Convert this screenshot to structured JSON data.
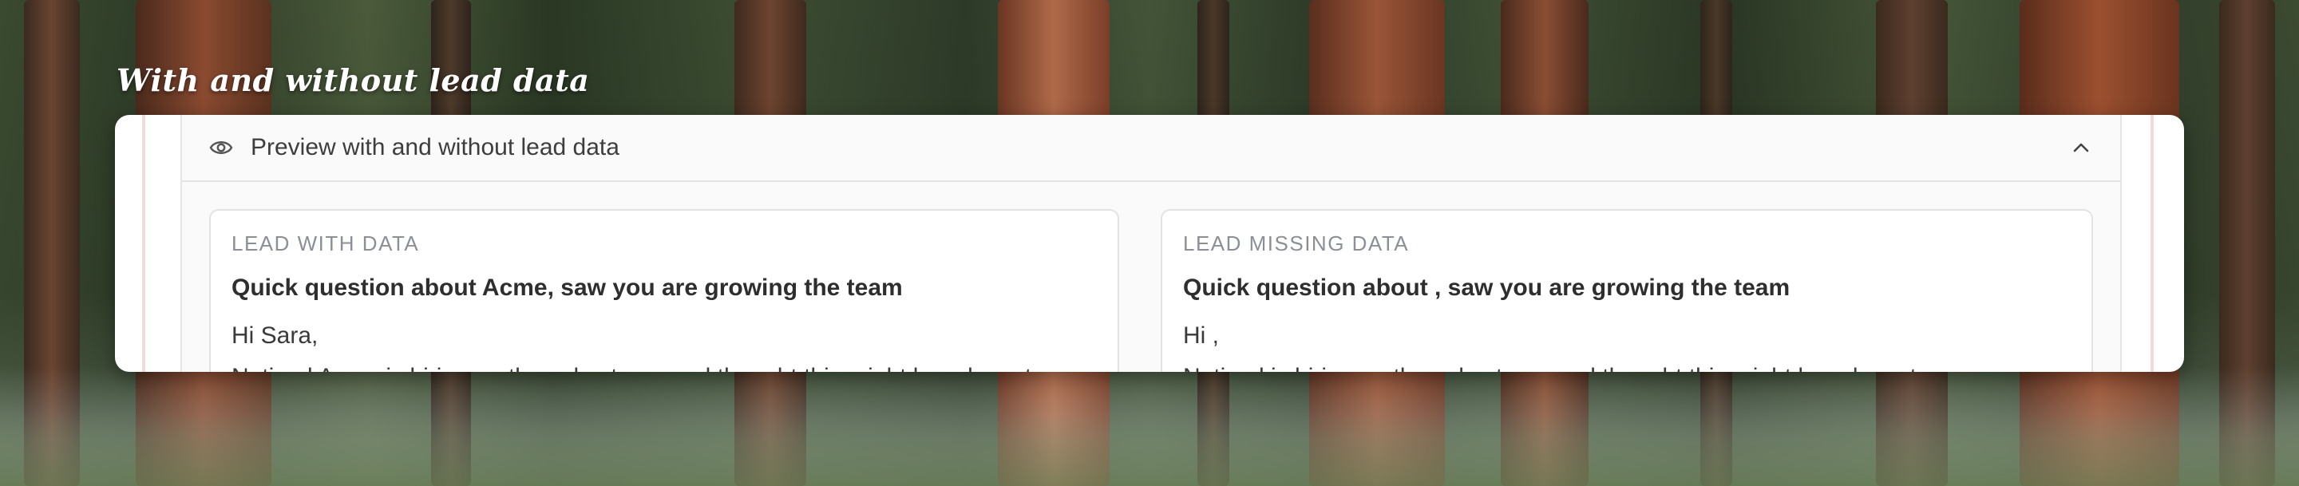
{
  "section": {
    "title": "With and without lead data"
  },
  "preview": {
    "header_label": "Preview with and without lead data",
    "eye_icon": "eye-icon",
    "toggle_icon": "chevron-up-icon",
    "expanded": true
  },
  "with_data": {
    "label": "LEAD WITH DATA",
    "subject": "Quick question about Acme, saw you are growing the team",
    "greeting": "Hi Sara,",
    "body_line": "Noticed Acme is hiring on the sales team and thought this might be relevant"
  },
  "missing_data": {
    "label": "LEAD MISSING DATA",
    "subject": "Quick question about , saw you are growing the team",
    "greeting": "Hi ,",
    "body_line": "Noticed  is hiring on the sales team and thought this might be relevant"
  },
  "colors": {
    "accent_edge": "#f1dcd8",
    "label_gray": "#8c8f96",
    "text_dark": "#2e2e2e"
  }
}
